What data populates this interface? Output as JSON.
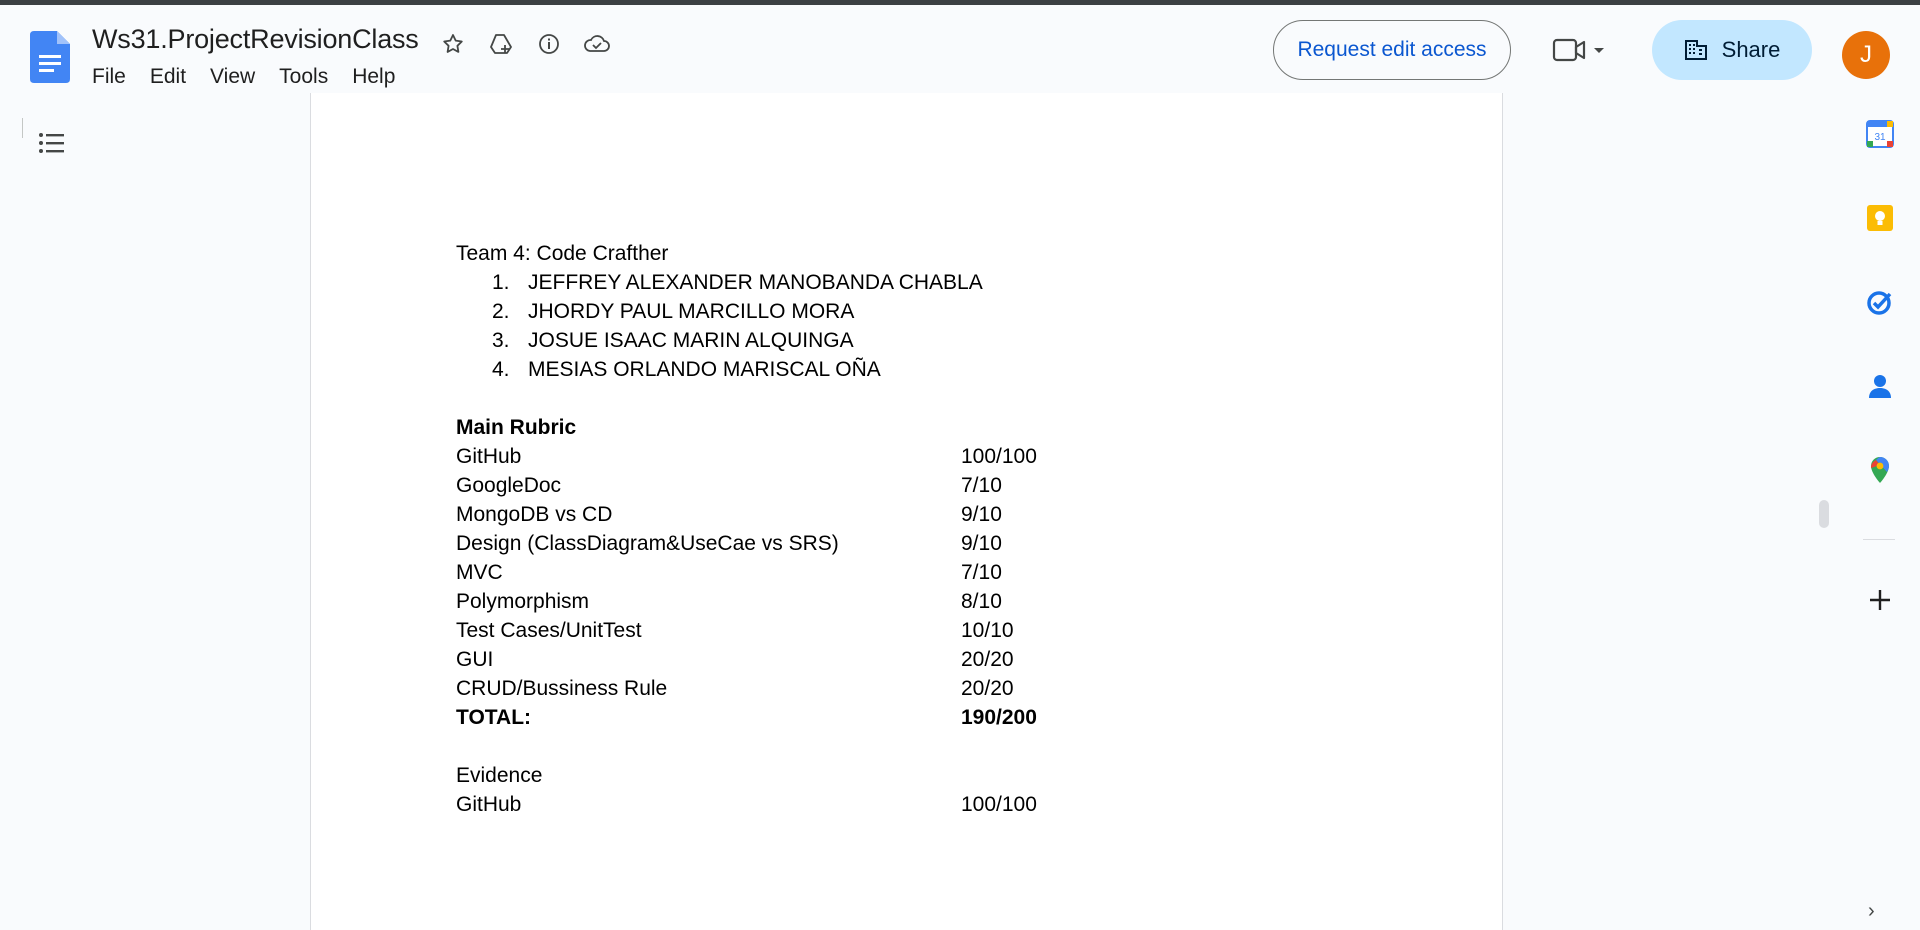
{
  "header": {
    "doc_title": "Ws31.ProjectRevisionClass",
    "menu": [
      "File",
      "Edit",
      "View",
      "Tools",
      "Help"
    ],
    "request_edit_label": "Request edit access",
    "share_label": "Share",
    "avatar_letter": "J"
  },
  "document": {
    "team_line": "Team 4: Code Crafther",
    "members": [
      {
        "num": "1.",
        "name": "JEFFREY ALEXANDER MANOBANDA CHABLA"
      },
      {
        "num": "2.",
        "name": "JHORDY PAUL MARCILLO MORA"
      },
      {
        "num": "3.",
        "name": "JOSUE ISAAC MARIN ALQUINGA"
      },
      {
        "num": "4.",
        "name": "MESIAS ORLANDO MARISCAL OÑA"
      }
    ],
    "rubric_heading": "Main Rubric",
    "rubric": [
      {
        "item": "GitHub",
        "score": "100/100"
      },
      {
        "item": "GoogleDoc",
        "score": "7/10"
      },
      {
        "item": "MongoDB vs CD",
        "score": "9/10"
      },
      {
        "item": "Design (ClassDiagram&UseCae vs SRS)",
        "score": "9/10"
      },
      {
        "item": "MVC",
        "score": "7/10"
      },
      {
        "item": "Polymorphism",
        "score": "8/10"
      },
      {
        "item": "Test Cases/UnitTest",
        "score": "10/10"
      },
      {
        "item": "GUI",
        "score": "20/20"
      },
      {
        "item": "CRUD/Bussiness Rule",
        "score": "20/20"
      }
    ],
    "total_label": "TOTAL:",
    "total_score": "190/200",
    "evidence_heading": "Evidence",
    "evidence": [
      {
        "item": "GitHub",
        "score": "100/100"
      }
    ]
  },
  "side_panel": {
    "calendar_day": "31",
    "icons": [
      "calendar-icon",
      "keep-icon",
      "tasks-icon",
      "contacts-icon",
      "maps-icon",
      "add-icon"
    ]
  },
  "colors": {
    "accent_blue": "#0b57d0",
    "share_bg": "#c2e7ff",
    "avatar_bg": "#e8710a",
    "docs_blue": "#4285f4"
  }
}
